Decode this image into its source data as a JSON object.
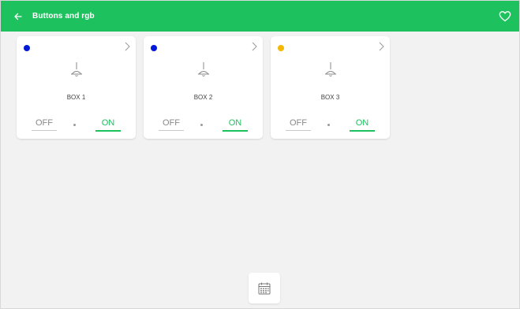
{
  "header": {
    "back_icon": "arrow-left-icon",
    "title": "Buttons and rgb",
    "favorite_icon": "heart-icon",
    "bar_color": "#1dc25f"
  },
  "cards": [
    {
      "name": "BOX 1",
      "status_color": "#0018d8",
      "off_label": "OFF",
      "on_label": "ON",
      "selected": "ON"
    },
    {
      "name": "BOX 2",
      "status_color": "#0018d8",
      "off_label": "OFF",
      "on_label": "ON",
      "selected": "ON"
    },
    {
      "name": "BOX 3",
      "status_color": "#f5b800",
      "off_label": "OFF",
      "on_label": "ON",
      "selected": "ON"
    }
  ],
  "footer": {
    "icon": "calendar-icon"
  }
}
